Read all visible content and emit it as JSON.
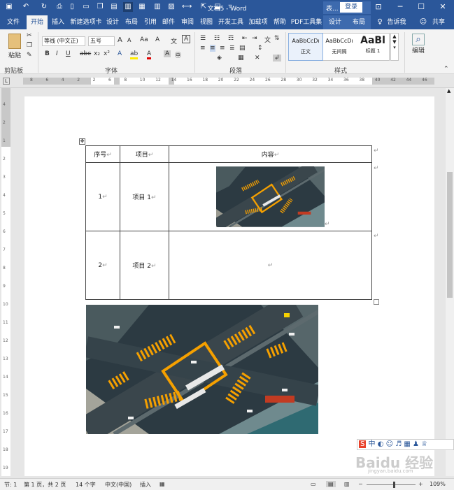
{
  "titlebar": {
    "title": "文档5 - Word",
    "login": "登录",
    "user": "表..."
  },
  "tabs": {
    "file": "文件",
    "home": "开始",
    "insert": "插入",
    "newtab": "新建选项卡",
    "design": "设计",
    "layout": "布局",
    "references": "引用",
    "mailings": "邮件",
    "review": "审阅",
    "view": "视图",
    "developer": "开发工具",
    "addins": "加载项",
    "help": "帮助",
    "pdf": "PDF工具集",
    "ctx_design": "设计",
    "ctx_layout": "布局",
    "tellme": "告诉我",
    "share": "共享"
  },
  "ribbon": {
    "paste": "粘贴",
    "clipboard": "剪贴板",
    "font_name": "等线 (中文正)",
    "font_size": "五号",
    "font_group": "字体",
    "paragraph_group": "段落",
    "style_group": "样式",
    "editing": "编辑",
    "styles": [
      {
        "preview": "AaBbCcDı",
        "name": "正文"
      },
      {
        "preview": "AaBbCcDı",
        "name": "无间隔"
      },
      {
        "preview": "AaBl",
        "name": "标题 1"
      }
    ]
  },
  "ruler": {
    "h_ticks": [
      "8",
      "6",
      "4",
      "2",
      "2",
      "6",
      "8",
      "10",
      "12",
      "14",
      "16",
      "18",
      "20",
      "22",
      "24",
      "26",
      "28",
      "30",
      "32",
      "34",
      "36",
      "38",
      "40",
      "42",
      "44",
      "46"
    ],
    "v_ticks": [
      "4",
      "2",
      "1",
      "2",
      "3",
      "4",
      "5",
      "6",
      "7",
      "8",
      "9",
      "10",
      "11",
      "12",
      "13",
      "14",
      "15",
      "16",
      "17",
      "18",
      "19"
    ]
  },
  "table": {
    "headers": [
      "序号",
      "项目",
      "内容"
    ],
    "rows": [
      {
        "num": "1",
        "item": "项目 1"
      },
      {
        "num": "2",
        "item": "项目 2"
      }
    ]
  },
  "statusbar": {
    "section": "节: 1",
    "page": "第 1 页，共 2 页",
    "words": "14 个字",
    "lang": "中文(中国)",
    "mode": "插入",
    "zoom": "109%"
  },
  "watermark": {
    "text": "Baidu 经验",
    "sub": "jingyan.baidu.com"
  },
  "colors": {
    "accent": "#2b579a"
  }
}
